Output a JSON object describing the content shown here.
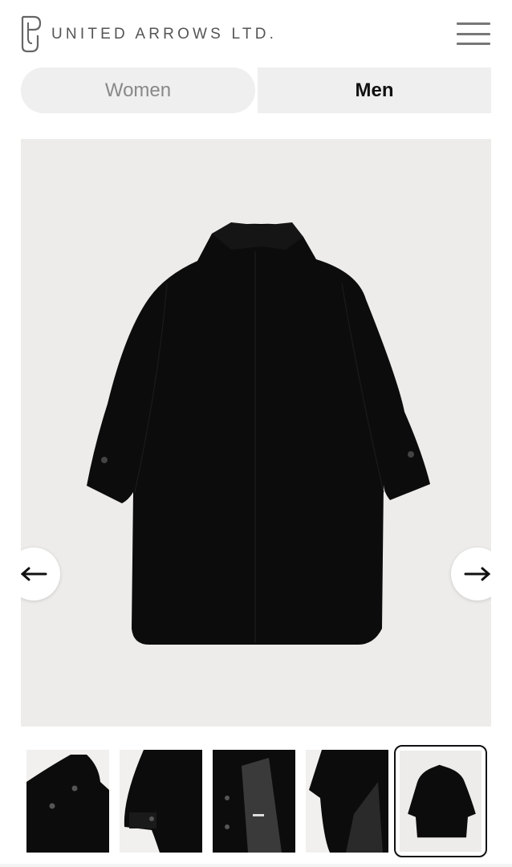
{
  "header": {
    "brand": "UNITED ARROWS LTD.",
    "logo_icon": "ua-monogram-icon",
    "menu_icon": "hamburger-menu-icon"
  },
  "tabs": [
    {
      "label": "Women",
      "selected": false
    },
    {
      "label": "Men",
      "selected": true
    }
  ],
  "gallery": {
    "image": "black-coat-back-view",
    "prev_icon": "arrow-left-icon",
    "next_icon": "arrow-right-icon",
    "thumbnail_count": 5,
    "active_thumbnail": 5
  },
  "colors": {
    "background": "#ffffff",
    "tab_bg": "#efefef",
    "photo_bg": "#edecea",
    "product": "#0b0b0b"
  }
}
